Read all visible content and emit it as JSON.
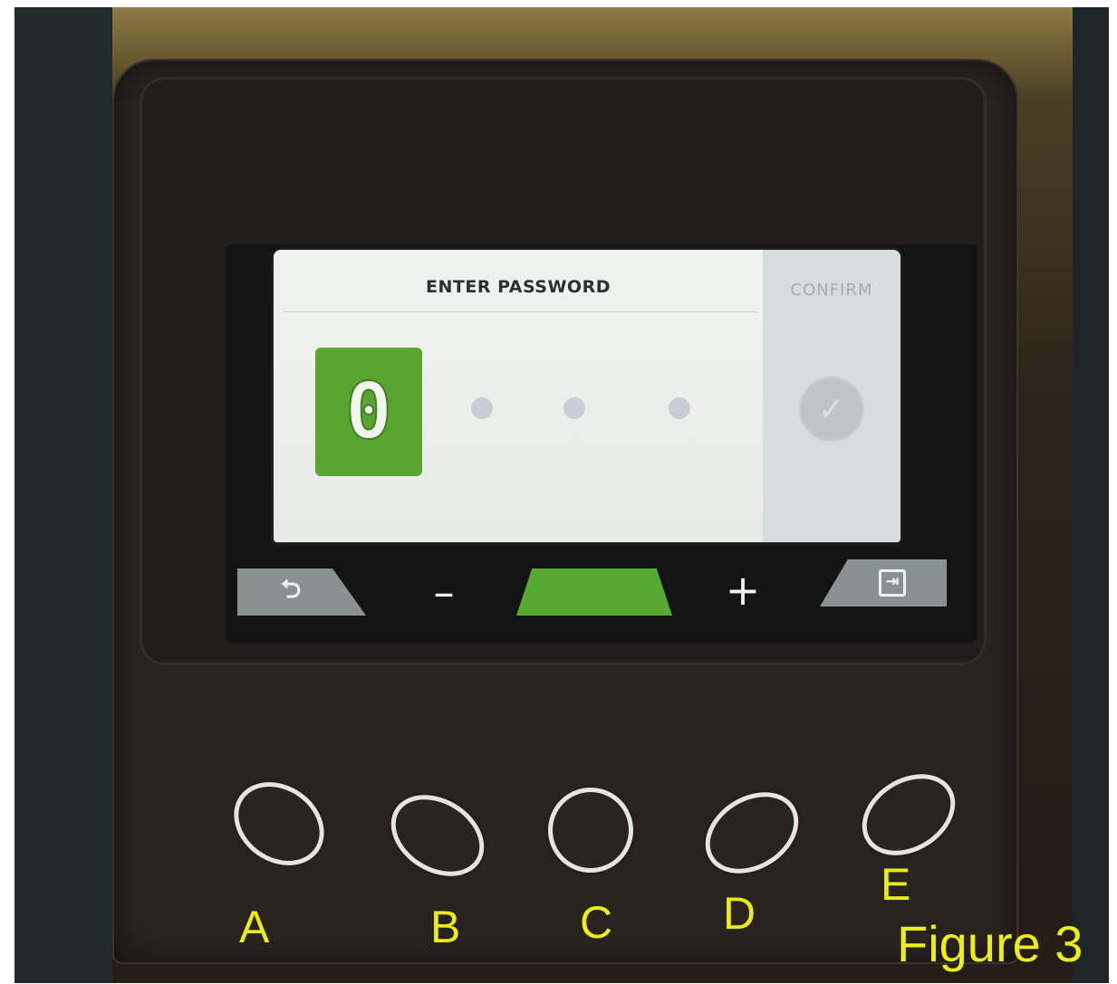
{
  "screen": {
    "title": "ENTER PASSWORD",
    "digits": [
      {
        "value": "0",
        "active": true
      },
      {
        "value": "",
        "active": false
      },
      {
        "value": "",
        "active": false
      },
      {
        "value": "",
        "active": false
      }
    ],
    "confirm_label": "CONFIRM",
    "confirm_icon": "checkmark-icon"
  },
  "softkeys": [
    {
      "id": "back",
      "icon": "back-arrow-icon",
      "symbol": "⮌"
    },
    {
      "id": "minus",
      "label": "–"
    },
    {
      "id": "select",
      "label": ""
    },
    {
      "id": "plus",
      "label": "+"
    },
    {
      "id": "exit",
      "icon": "exit-icon",
      "symbol": "⇥"
    }
  ],
  "physical_buttons": [
    "A",
    "B",
    "C",
    "D",
    "E"
  ],
  "figure_caption": "Figure 3",
  "colors": {
    "accent_green": "#5aa532",
    "caption_yellow": "#ecec1a",
    "softkey_gray": "#8b9190"
  }
}
